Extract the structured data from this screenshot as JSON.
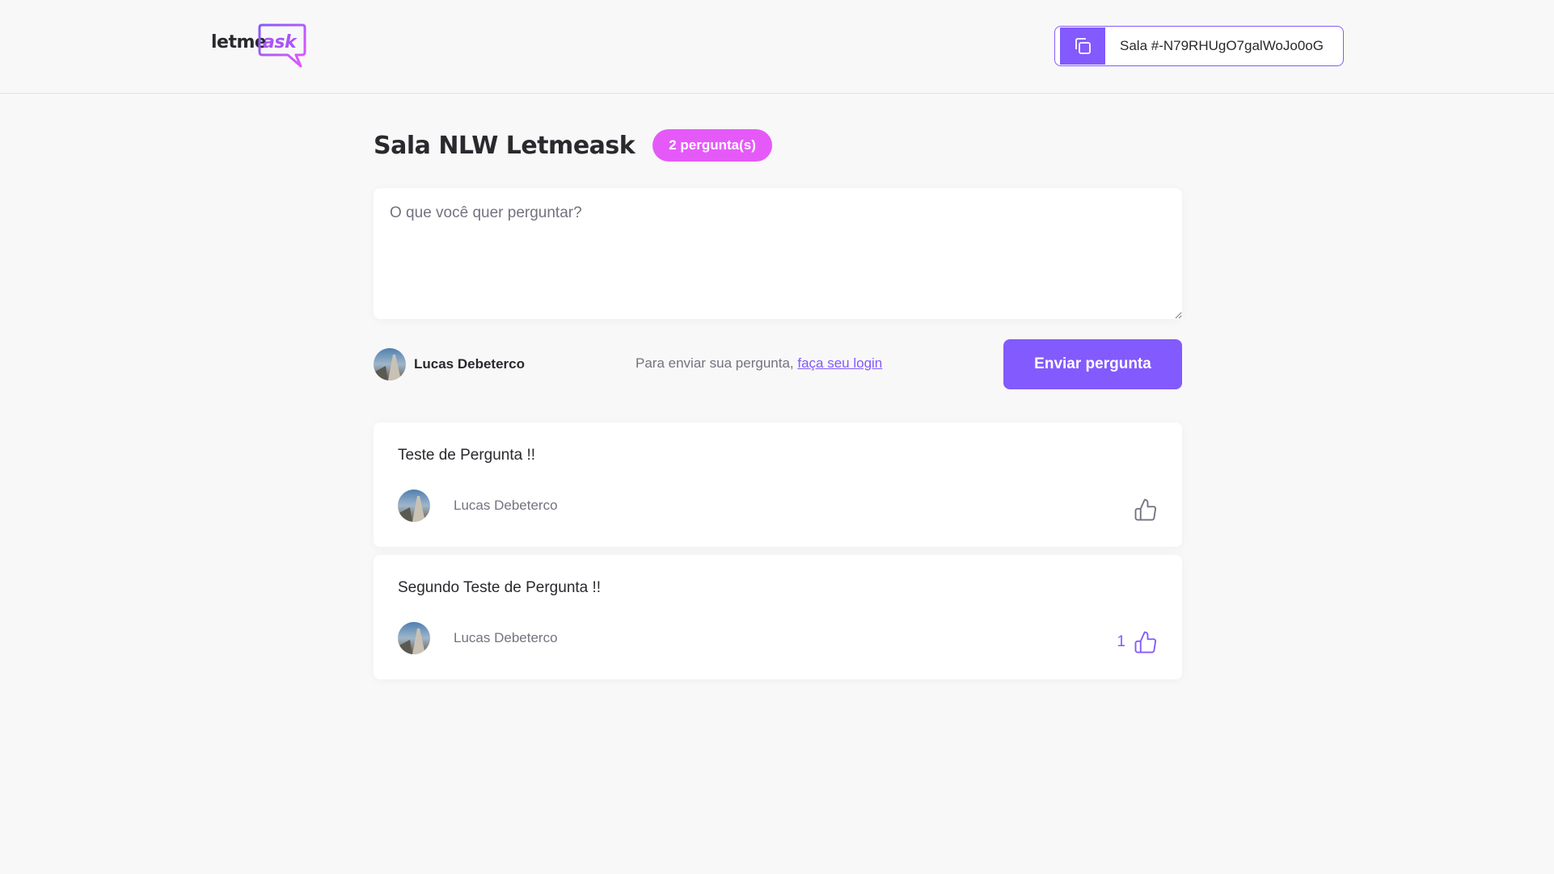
{
  "header": {
    "logo_text_main": "letme",
    "logo_text_accent": "ask",
    "room_code_label": "Sala #-N79RHUgO7galWoJo0oG"
  },
  "room": {
    "title": "Sala NLW Letmeask",
    "question_count_badge": "2 pergunta(s)"
  },
  "form": {
    "placeholder": "O que você quer perguntar?",
    "user_name": "Lucas Debeterco",
    "login_prefix": "Para enviar sua pergunta, ",
    "login_link": "faça seu login",
    "submit_label": "Enviar pergunta"
  },
  "questions": [
    {
      "content": "Teste de Pergunta !!",
      "author": "Lucas Debeterco",
      "like_count": "",
      "liked": false
    },
    {
      "content": "Segundo Teste de Pergunta !!",
      "author": "Lucas Debeterco",
      "like_count": "1",
      "liked": true
    }
  ],
  "colors": {
    "primary": "#835afd",
    "badge": "#e559f9",
    "background": "#f8f8f8",
    "text": "#29292e",
    "muted": "#737380"
  },
  "icons": {
    "copy": "copy-icon",
    "like": "thumbs-up-icon"
  }
}
